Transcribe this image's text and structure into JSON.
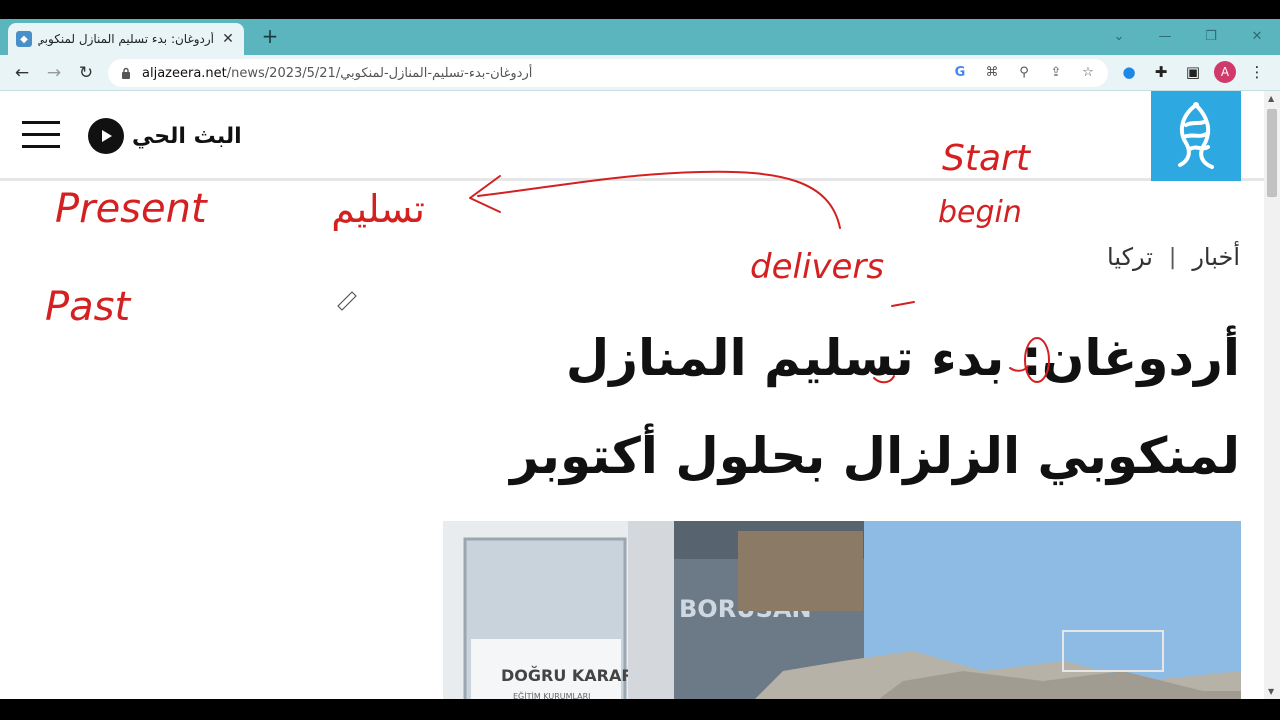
{
  "browser": {
    "tab_title": "أردوغان: بدء تسليم المنازل لمنكوبي",
    "tab_close": "✕",
    "new_tab": "+",
    "url_host": "aljazeera.net",
    "url_path": "/news/2023/5/21/أردوغان-بدء-تسليم-المنازل-لمنكوبي",
    "avatar_letter": "A",
    "icons": {
      "back": "back-arrow-icon",
      "forward": "forward-arrow-icon",
      "reload": "reload-icon",
      "lock": "lock-icon",
      "google": "google-icon",
      "translate": "translate-icon",
      "zoom": "zoom-icon",
      "share": "share-icon",
      "bookmark": "star-icon",
      "extension_drop": "water-drop-icon",
      "extensions": "puzzle-icon",
      "sidepanel": "side-panel-icon"
    }
  },
  "site": {
    "live_label": "البث الحي",
    "brand_color": "#2ea8e1"
  },
  "article": {
    "breadcrumb": [
      "أخبار",
      "تركيا"
    ],
    "breadcrumb_separator": "|",
    "headline_line1": "أردوغان: بدء تسليم المنازل",
    "headline_line2": "لمنكوبي الزلزال بحلول أكتوبر"
  },
  "photo": {
    "sign_text": "BORUSAN",
    "banner_text": "DOĞRU KARAR",
    "banner_subtext": "EĞİTİM KURUMLARI"
  },
  "annotations": {
    "ink_color": "#d42020",
    "present": "Present",
    "present_arabic": "تسليم",
    "past": "Past",
    "delivers": "delivers",
    "start": "Start",
    "begin": "begin"
  }
}
